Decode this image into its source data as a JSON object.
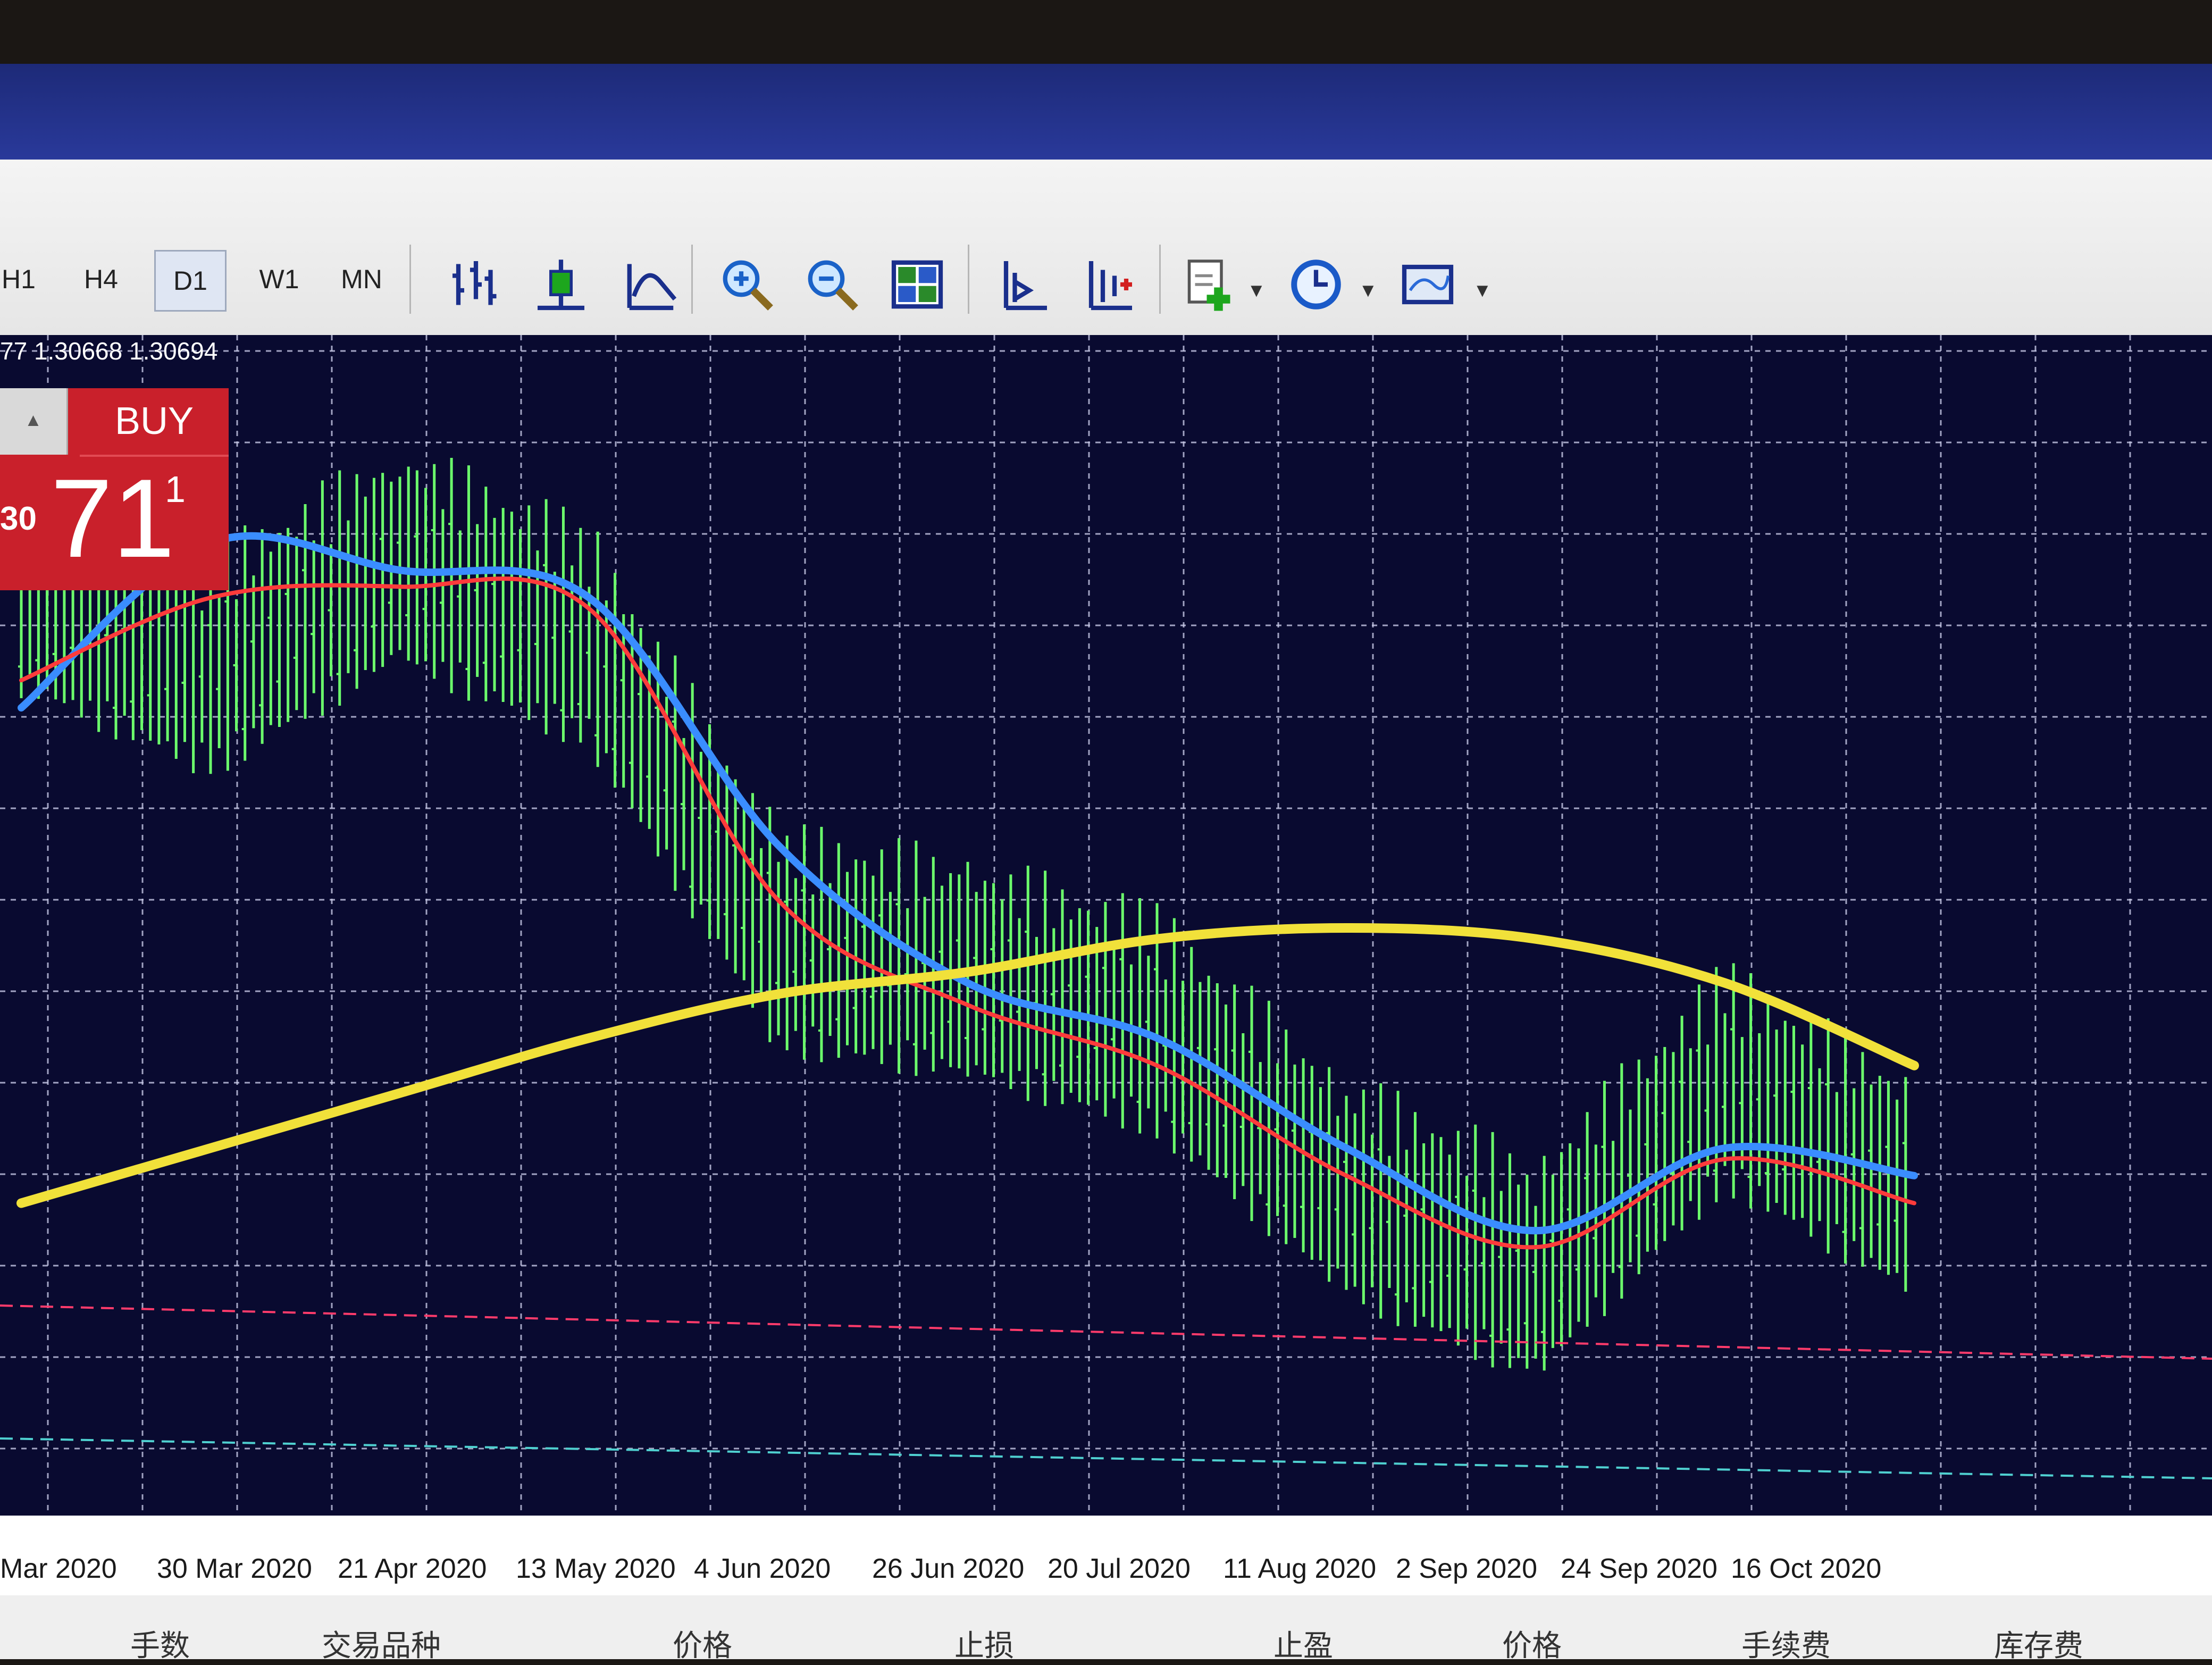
{
  "toolbar": {
    "timeframes": [
      "H1",
      "H4",
      "D1",
      "W1",
      "MN"
    ],
    "active_timeframe": "D1",
    "icons": [
      "bar-chart-icon",
      "candlestick-icon",
      "line-chart-icon",
      "zoom-in-icon",
      "zoom-out-icon",
      "tile-windows-icon",
      "chart-shift-icon",
      "auto-scroll-icon",
      "indicators-icon",
      "periods-icon",
      "templates-icon"
    ]
  },
  "quote_line": "77 1.30668 1.30694",
  "buy_panel": {
    "label": "BUY",
    "price_prefix": "30",
    "price_big": "71",
    "price_sup": "1",
    "color": "#c9202b"
  },
  "chart_data": {
    "type": "line",
    "x": [
      "Mar 2020",
      "30 Mar 2020",
      "21 Apr 2020",
      "13 May 2020",
      "4 Jun 2020",
      "26 Jun 2020",
      "20 Jul 2020",
      "11 Aug 2020",
      "2 Sep 2020",
      "24 Sep 2020",
      "16 Oct 2020"
    ],
    "series": [
      {
        "color": "#3a8dff",
        "values": [
          1.22,
          1.25,
          1.245,
          1.24,
          1.195,
          1.17,
          1.16,
          1.14,
          1.125,
          1.14,
          1.135
        ]
      },
      {
        "color": "#ff3b3b",
        "values": [
          1.225,
          1.24,
          1.242,
          1.238,
          1.185,
          1.166,
          1.155,
          1.135,
          1.122,
          1.138,
          1.13
        ]
      },
      {
        "color": "#f1e13a",
        "values": [
          1.13,
          1.14,
          1.15,
          1.16,
          1.168,
          1.172,
          1.178,
          1.18,
          1.178,
          1.17,
          1.155
        ]
      },
      {
        "color": "#6cff6c",
        "values": [
          1.24,
          1.225,
          1.245,
          1.23,
          1.175,
          1.17,
          1.16,
          1.13,
          1.115,
          1.15,
          1.13
        ]
      }
    ],
    "ylim": [
      1.08,
      1.28
    ],
    "grid": true
  },
  "date_axis": [
    "Mar 2020",
    "30 Mar 2020",
    "21 Apr 2020",
    "13 May 2020",
    "4 Jun 2020",
    "26 Jun 2020",
    "20 Jul 2020",
    "11 Aug 2020",
    "2 Sep 2020",
    "24 Sep 2020",
    "16 Oct 2020"
  ],
  "footer": [
    "手数",
    "交易品种",
    "价格",
    "止损",
    "止盈",
    "价格",
    "手续费",
    "库存费"
  ]
}
